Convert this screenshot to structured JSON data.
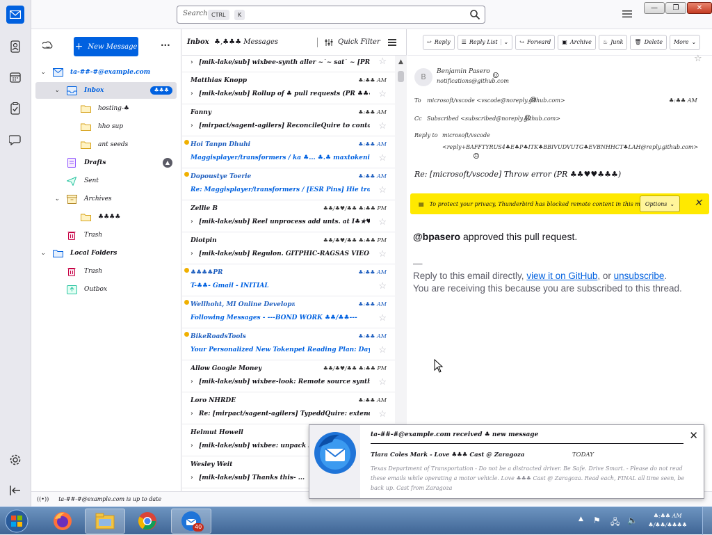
{
  "search": {
    "placeholder": "Search...",
    "key1": "CTRL",
    "key2": "K"
  },
  "window": {
    "min": "—",
    "max": "❐",
    "close": "✕"
  },
  "folder_pane": {
    "new_message": "New Message",
    "more": "···",
    "folders": [
      {
        "label": "ta-##-#@example.com",
        "level": 0,
        "icon": "mail-account-icon",
        "twisty": "down"
      },
      {
        "label": "Inbox",
        "level": 1,
        "icon": "inbox-icon",
        "twisty": "down",
        "badge": "♣♣♣",
        "selected": true
      },
      {
        "label": "hosting-♣",
        "level": 2,
        "icon": "folder-icon"
      },
      {
        "label": "hho sup",
        "level": 2,
        "icon": "folder-icon"
      },
      {
        "label": "ant seeds",
        "level": 2,
        "icon": "folder-icon"
      },
      {
        "label": "Drafts",
        "level": 1,
        "icon": "drafts-icon",
        "badge": "▲",
        "badge_grey": true
      },
      {
        "label": "Sent",
        "level": 1,
        "icon": "sent-icon"
      },
      {
        "label": "Archives",
        "level": 1,
        "icon": "archive-icon",
        "twisty": "down"
      },
      {
        "label": "♣♣♣♣",
        "level": 2,
        "icon": "folder-icon"
      },
      {
        "label": "Trash",
        "level": 1,
        "icon": "trash-icon"
      },
      {
        "label": "Local Folders",
        "level": 0,
        "icon": "local-folders-icon",
        "twisty": "down"
      },
      {
        "label": "Trash",
        "level": 1,
        "icon": "trash-icon"
      },
      {
        "label": "Outbox",
        "level": 1,
        "icon": "outbox-icon"
      }
    ]
  },
  "thread_pane": {
    "folder_name": "Inbox",
    "count": "♣,♣♣♣ Messages",
    "quick_filter": "Quick Filter",
    "messages": [
      {
        "from": "",
        "date": "",
        "subject": "[mik-lake/sub] wixbee-synth aller ~`~ sat` ~ [PR -",
        "unread": false,
        "dot": false
      },
      {
        "from": "Matthias Knopp",
        "date": "♣:♣♣ AM",
        "subject": "[mik-lake/sub] Rollup of ♣ pull requests (PR ♣♣♣★♣...",
        "unread": false,
        "dot": false
      },
      {
        "from": "Fanny",
        "date": "♣:♣♣ AM",
        "subject": "[mirpact/sagent-agilers] ReconcileQuire to contain. ulltt. ronip...",
        "unread": false,
        "dot": false
      },
      {
        "from": "Hoi Tanpn Dhuhi",
        "date": "♣:♣♣ AM",
        "subject": "Maggisplayer/transformers / ka ♣... ♣.♣ maxtokenizer. Tensors, hu...",
        "unread": true,
        "dot": true
      },
      {
        "from": "Dopoustye Toerie",
        "date": "♣:♣♣ AM",
        "subject": "Re: Maggisplayer/transformers / [ESR Pins] Hie tron hoque ♣...",
        "unread": true,
        "dot": true
      },
      {
        "from": "Zellie B",
        "date": "♣♣/♣♥/♣♣ ♣:♣♣ PM",
        "subject": "[mik-lake/sub] Reel unprocess add unts. at I♣★♥★♣♣ (...",
        "unread": false,
        "dot": false
      },
      {
        "from": "Diotpin",
        "date": "♣♣/♣♥/♣♣ ♣:♣♣ PM",
        "subject": "[mik-lake/sub] Regulon. GITPHIC-RAGSAS VIEO-...",
        "unread": false,
        "dot": false
      },
      {
        "from": "♣♣♣♣PR",
        "date": "♣:♣♣ AM",
        "subject": "T-♣♣- Gmail - INITIAL",
        "unread": true,
        "dot": true
      },
      {
        "from": "Wellhoht, MI Online Development",
        "date": "♣:♣♣ AM",
        "subject": "Following Messages - ---BOND WORK ♣♣/♣♣---",
        "unread": true,
        "dot": true
      },
      {
        "from": "BikeRoadsTools",
        "date": "♣:♣♣ AM",
        "subject": "Your Personalized New Tokenpet Reading Plan: Day 5",
        "unread": true,
        "dot": true
      },
      {
        "from": "Allow Google Money",
        "date": "♣♣/♣♥/♣♣ ♣:♣♣ PM",
        "subject": "[mik-lake/sub] wixbee-look: Remote source synthesis. (PR -...",
        "unread": false,
        "dot": false
      },
      {
        "from": "Loro NHRDE",
        "date": "♣:♣♣ AM",
        "subject": "Re: [mirpact/sagent-agilers] TypeddQuire: extend typed loop...",
        "unread": false,
        "dot": false
      },
      {
        "from": "Helmut Howell",
        "date": "♣",
        "subject": "[mik-lake/sub] wixbee: unpack small br...",
        "unread": false,
        "dot": false
      },
      {
        "from": "Wesley Weit",
        "date": "",
        "subject": "[mik-lake/sub] Thanks this- ...",
        "unread": false,
        "dot": false
      }
    ]
  },
  "reading_pane": {
    "buttons": {
      "reply": "Reply",
      "reply_list": "Reply List",
      "forward": "Forward",
      "archive": "Archive",
      "junk": "Junk",
      "delete": "Delete",
      "more": "More"
    },
    "from_name": "Benjamin Pasero",
    "from_email": "notifications@github.com",
    "to_label": "To",
    "to_value": "microsoft/vscode <vscode@noreply.github.com>",
    "date": "♣:♣♣ AM",
    "cc_label": "Cc",
    "cc_value": "Subscribed <subscribed@noreply.github.com>",
    "reply_to_label": "Reply to",
    "reply_to_value1": "microsoft/vscode",
    "reply_to_value2": "<reply+BAFFTYRUS4♣E♣P♣ITK♣BBIVUDVUTG♣EVBNHHCT♣LAH@reply.github.com>",
    "subject": "Re: [microsoft/vscode] Throw error (PR ♣♣♥♥♣♣♣)",
    "notice_text": "To protect your privacy, Thunderbird has blocked remote content in this message.",
    "options_label": "Options",
    "body_user": "@bpasero",
    "body_action": " approved this pull request.",
    "body_sep": "—",
    "body_reply_pre": "Reply to this email directly, ",
    "body_link1": "view it on GitHub",
    "body_mid": ", or ",
    "body_link2": "unsubscribe",
    "body_end": ".",
    "body_reason": "You are receiving this because you are subscribed to this thread."
  },
  "status_bar": {
    "text": "ta-##-#@example.com is up to date"
  },
  "popup": {
    "title": "ta-##-#@example.com received ♣ new message",
    "from": "Tiara Coles Mark - Love ♣♣♣ Cast @ Zaragoza",
    "date": "TODAY",
    "preview": "Texas Department of Transportation - Do not be a distracted driver. Be Safe. Drive Smart. - Please do not read these emails while operating a motor vehicle. Love ♣♣♣ Cast @ Zaragoza. Read each, FINAL all time seen, be back up. Cast from Zaragoza"
  },
  "taskbar": {
    "badge": "40",
    "clock_time": "♣:♣♣ AM",
    "clock_date": "♣/♣♣/♣♣♣♣"
  },
  "colors": {
    "accent": "#0061e0",
    "notice": "#ffe900",
    "unread": "#0061e0",
    "taskbar": "#4a72a4"
  }
}
